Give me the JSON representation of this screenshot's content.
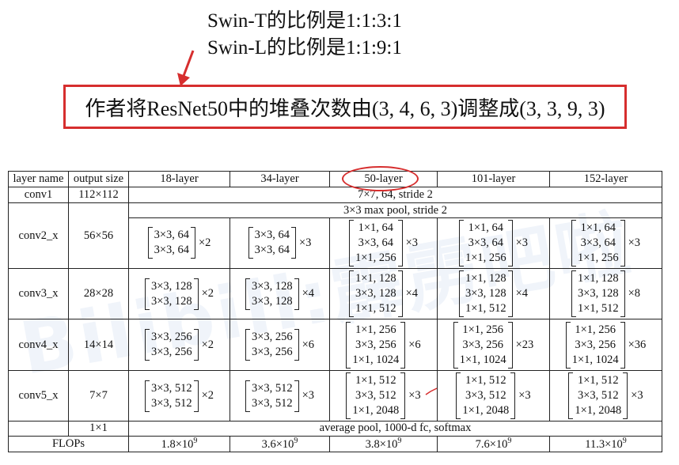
{
  "annotations": {
    "note1": "Swin-T的比例是1:1:3:1",
    "note2": "Swin-L的比例是1:1:9:1",
    "callout": "作者将ResNet50中的堆叠次数由(3, 4, 6, 3)调整成(3, 3, 9, 3)",
    "watermark": "Bilibili:霹雳吧啦",
    "accent_color": "#d62e2e"
  },
  "table": {
    "headers": [
      "layer name",
      "output size",
      "18-layer",
      "34-layer",
      "50-layer",
      "101-layer",
      "152-layer"
    ],
    "conv1": {
      "name": "conv1",
      "size": "112×112",
      "desc": "7×7, 64, stride 2"
    },
    "pool": "3×3 max pool, stride 2",
    "rows": [
      {
        "name": "conv2_x",
        "size": "56×56",
        "cells": [
          {
            "lines": [
              "3×3, 64",
              "3×3, 64"
            ],
            "mult": "×2"
          },
          {
            "lines": [
              "3×3, 64",
              "3×3, 64"
            ],
            "mult": "×3"
          },
          {
            "lines": [
              "1×1, 64",
              "3×3, 64",
              "1×1, 256"
            ],
            "mult": "×3"
          },
          {
            "lines": [
              "1×1, 64",
              "3×3, 64",
              "1×1, 256"
            ],
            "mult": "×3"
          },
          {
            "lines": [
              "1×1, 64",
              "3×3, 64",
              "1×1, 256"
            ],
            "mult": "×3"
          }
        ]
      },
      {
        "name": "conv3_x",
        "size": "28×28",
        "cells": [
          {
            "lines": [
              "3×3, 128",
              "3×3, 128"
            ],
            "mult": "×2"
          },
          {
            "lines": [
              "3×3, 128",
              "3×3, 128"
            ],
            "mult": "×4"
          },
          {
            "lines": [
              "1×1, 128",
              "3×3, 128",
              "1×1, 512"
            ],
            "mult": "×4"
          },
          {
            "lines": [
              "1×1, 128",
              "3×3, 128",
              "1×1, 512"
            ],
            "mult": "×4"
          },
          {
            "lines": [
              "1×1, 128",
              "3×3, 128",
              "1×1, 512"
            ],
            "mult": "×8"
          }
        ]
      },
      {
        "name": "conv4_x",
        "size": "14×14",
        "cells": [
          {
            "lines": [
              "3×3, 256",
              "3×3, 256"
            ],
            "mult": "×2"
          },
          {
            "lines": [
              "3×3, 256",
              "3×3, 256"
            ],
            "mult": "×6"
          },
          {
            "lines": [
              "1×1, 256",
              "3×3, 256",
              "1×1, 1024"
            ],
            "mult": "×6"
          },
          {
            "lines": [
              "1×1, 256",
              "3×3, 256",
              "1×1, 1024"
            ],
            "mult": "×23"
          },
          {
            "lines": [
              "1×1, 256",
              "3×3, 256",
              "1×1, 1024"
            ],
            "mult": "×36"
          }
        ]
      },
      {
        "name": "conv5_x",
        "size": "7×7",
        "cells": [
          {
            "lines": [
              "3×3, 512",
              "3×3, 512"
            ],
            "mult": "×2"
          },
          {
            "lines": [
              "3×3, 512",
              "3×3, 512"
            ],
            "mult": "×3"
          },
          {
            "lines": [
              "1×1, 512",
              "3×3, 512",
              "1×1, 2048"
            ],
            "mult": "×3"
          },
          {
            "lines": [
              "1×1, 512",
              "3×3, 512",
              "1×1, 2048"
            ],
            "mult": "×3"
          },
          {
            "lines": [
              "1×1, 512",
              "3×3, 512",
              "1×1, 2048"
            ],
            "mult": "×3"
          }
        ]
      }
    ],
    "final": {
      "size": "1×1",
      "desc": "average pool, 1000-d fc, softmax"
    },
    "flops": {
      "label": "FLOPs",
      "values": [
        {
          "base": "1.8×10",
          "exp": "9"
        },
        {
          "base": "3.6×10",
          "exp": "9"
        },
        {
          "base": "3.8×10",
          "exp": "9"
        },
        {
          "base": "7.6×10",
          "exp": "9"
        },
        {
          "base": "11.3×10",
          "exp": "9"
        }
      ]
    }
  }
}
